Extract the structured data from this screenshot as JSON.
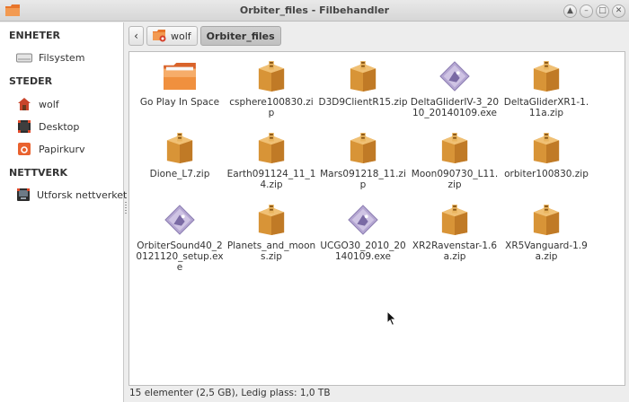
{
  "window": {
    "title": "Orbiter_files - Filbehandler"
  },
  "sidebar": {
    "sections": [
      {
        "title": "ENHETER",
        "items": [
          {
            "label": "Filsystem",
            "icon": "drive-icon"
          }
        ]
      },
      {
        "title": "STEDER",
        "items": [
          {
            "label": "wolf",
            "icon": "home-icon"
          },
          {
            "label": "Desktop",
            "icon": "desktop-icon"
          },
          {
            "label": "Papirkurv",
            "icon": "trash-icon"
          }
        ]
      },
      {
        "title": "NETTVERK",
        "items": [
          {
            "label": "Utforsk nettverket",
            "icon": "network-icon"
          }
        ]
      }
    ]
  },
  "pathbar": {
    "crumbs": [
      {
        "label": "wolf"
      },
      {
        "label": "Orbiter_files"
      }
    ]
  },
  "files": [
    {
      "name": "Go Play In Space",
      "type": "folder"
    },
    {
      "name": "csphere100830.zip",
      "type": "zip"
    },
    {
      "name": "D3D9ClientR15.zip",
      "type": "zip"
    },
    {
      "name": "DeltaGliderIV-3_2010_20140109.exe",
      "type": "exe"
    },
    {
      "name": "DeltaGliderXR1-1.11a.zip",
      "type": "zip"
    },
    {
      "name": "Dione_L7.zip",
      "type": "zip"
    },
    {
      "name": "Earth091124_11_14.zip",
      "type": "zip"
    },
    {
      "name": "Mars091218_11.zip",
      "type": "zip"
    },
    {
      "name": "Moon090730_L11.zip",
      "type": "zip"
    },
    {
      "name": "orbiter100830.zip",
      "type": "zip"
    },
    {
      "name": "OrbiterSound40_20121120_setup.exe",
      "type": "exe"
    },
    {
      "name": "Planets_and_moons.zip",
      "type": "zip"
    },
    {
      "name": "UCGO30_2010_20140109.exe",
      "type": "exe"
    },
    {
      "name": "XR2Ravenstar-1.6a.zip",
      "type": "zip"
    },
    {
      "name": "XR5Vanguard-1.9a.zip",
      "type": "zip"
    }
  ],
  "status": {
    "text": "15 elementer (2,5 GB), Ledig plass: 1,0 TB"
  }
}
